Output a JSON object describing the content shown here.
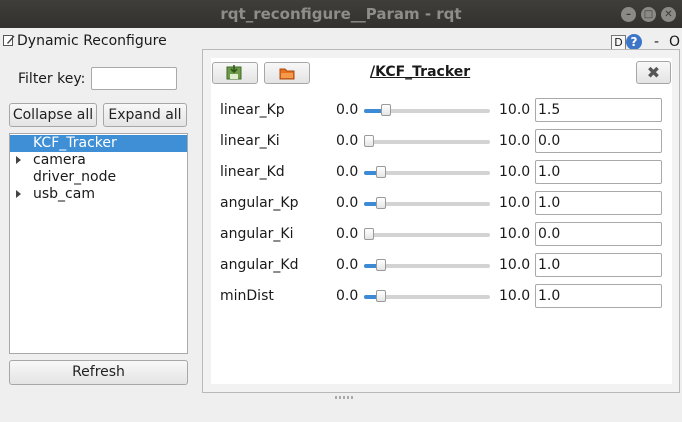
{
  "window": {
    "title": "rqt_reconfigure__Param - rqt"
  },
  "plugin": {
    "title": "Dynamic Reconfigure",
    "help_d": "D",
    "help_q": "?",
    "dash": "-",
    "o": "O"
  },
  "filter": {
    "label": "Filter key:",
    "value": ""
  },
  "buttons": {
    "collapse": "Collapse all",
    "expand": "Expand all",
    "refresh": "Refresh"
  },
  "tree": [
    {
      "label": "KCF_Tracker",
      "selected": true,
      "expandable": false
    },
    {
      "label": "camera",
      "selected": false,
      "expandable": true
    },
    {
      "label": "driver_node",
      "selected": false,
      "expandable": false
    },
    {
      "label": "usb_cam",
      "selected": false,
      "expandable": true
    }
  ],
  "panel": {
    "node_title": "/KCF_Tracker",
    "close": "✖",
    "icons": [
      "save-icon",
      "load-icon"
    ]
  },
  "params": [
    {
      "name": "linear_Kp",
      "min": "0.0",
      "max": "10.0",
      "value": "1.5",
      "fraction": 0.15
    },
    {
      "name": "linear_Ki",
      "min": "0.0",
      "max": "10.0",
      "value": "0.0",
      "fraction": 0.0
    },
    {
      "name": "linear_Kd",
      "min": "0.0",
      "max": "10.0",
      "value": "1.0",
      "fraction": 0.1
    },
    {
      "name": "angular_Kp",
      "min": "0.0",
      "max": "10.0",
      "value": "1.0",
      "fraction": 0.1
    },
    {
      "name": "angular_Ki",
      "min": "0.0",
      "max": "10.0",
      "value": "0.0",
      "fraction": 0.0
    },
    {
      "name": "angular_Kd",
      "min": "0.0",
      "max": "10.0",
      "value": "1.0",
      "fraction": 0.1
    },
    {
      "name": "minDist",
      "min": "0.0",
      "max": "10.0",
      "value": "1.0",
      "fraction": 0.1
    }
  ],
  "colors": {
    "accent": "#3e8fd6",
    "titlebar": "#3a3935"
  }
}
